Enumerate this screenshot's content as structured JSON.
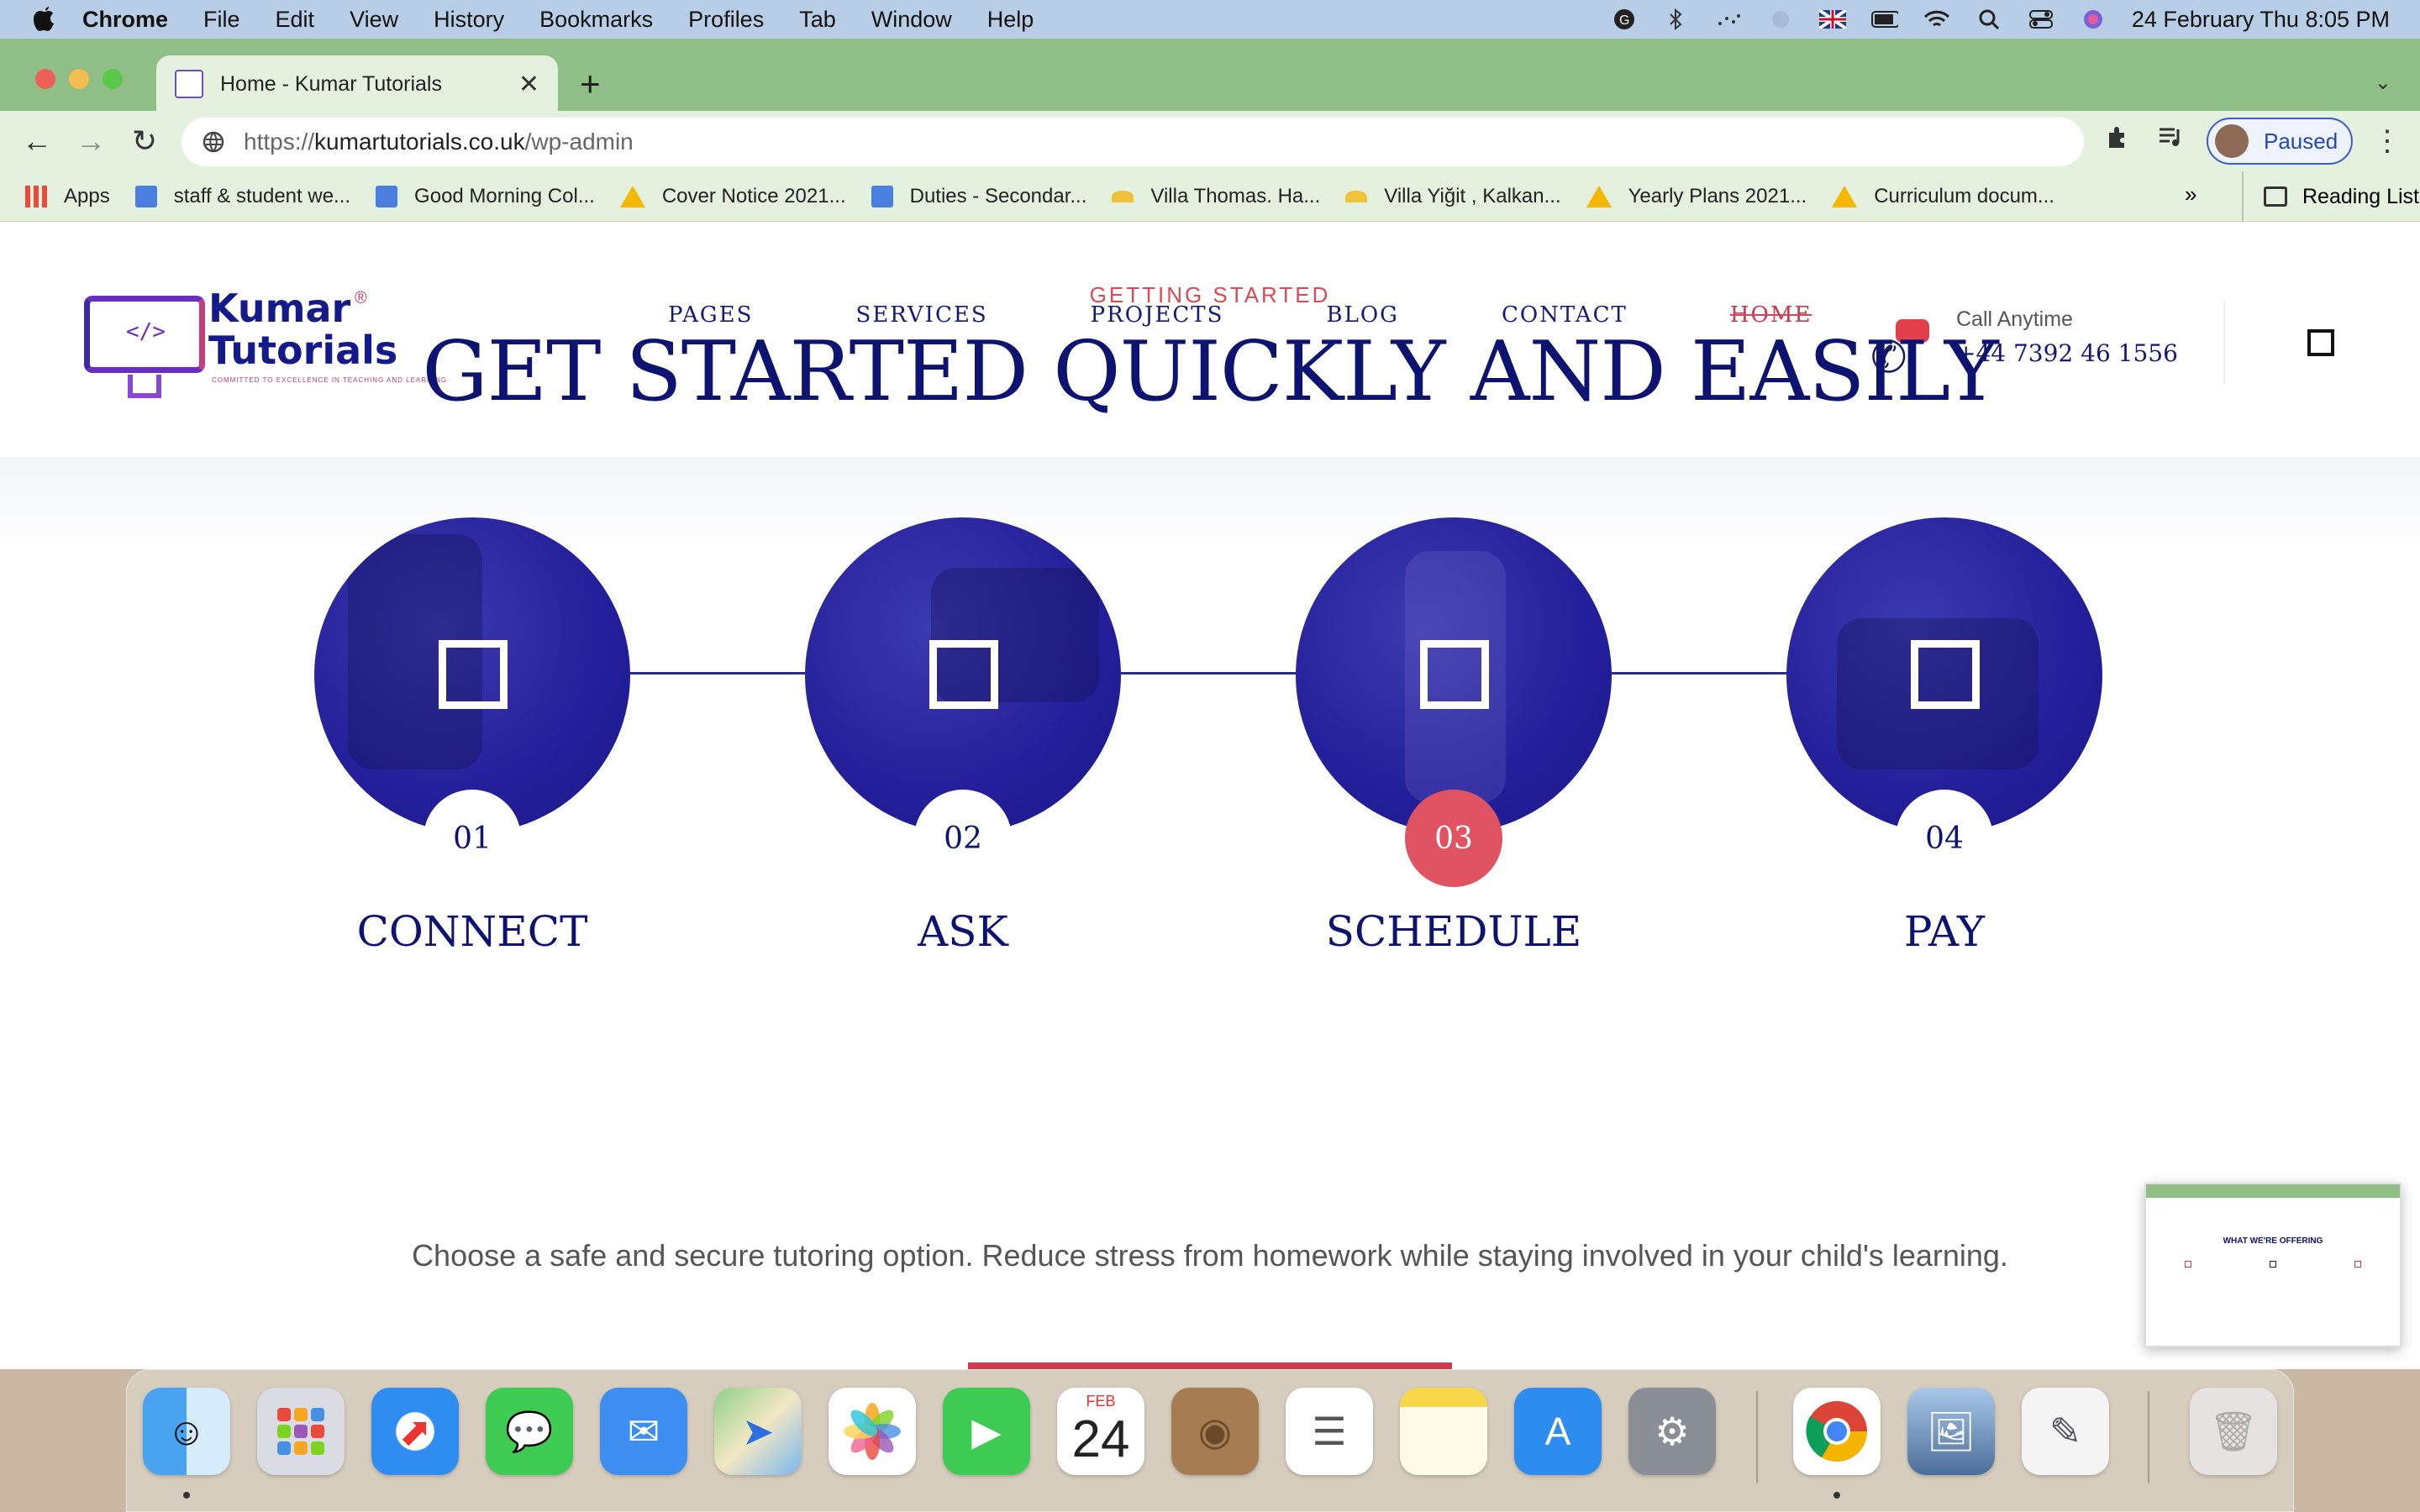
{
  "menubar": {
    "app": "Chrome",
    "items": [
      "File",
      "Edit",
      "View",
      "History",
      "Bookmarks",
      "Profiles",
      "Tab",
      "Window",
      "Help"
    ],
    "datetime": "24 February Thu  8:05 PM"
  },
  "browser": {
    "tab_title": "Home - Kumar Tutorials",
    "url_prefix": "https://",
    "url_host": "kumartutorials.co.uk",
    "url_path": "/wp-admin",
    "profile_status": "Paused",
    "bookmarks": [
      {
        "label": "Apps",
        "icon": "apps-grid-icon"
      },
      {
        "label": "staff & student we...",
        "icon": "docs-icon"
      },
      {
        "label": "Good Morning Col...",
        "icon": "docs-icon"
      },
      {
        "label": "Cover Notice 2021...",
        "icon": "drive-icon"
      },
      {
        "label": "Duties - Secondar...",
        "icon": "docs-icon"
      },
      {
        "label": "Villa Thomas. Ha...",
        "icon": "sunset-icon"
      },
      {
        "label": "Villa Yiğit , Kalkan...",
        "icon": "sunset-icon"
      },
      {
        "label": "Yearly Plans 2021...",
        "icon": "drive-icon"
      },
      {
        "label": "Curriculum docum...",
        "icon": "drive-icon"
      }
    ],
    "bookmarks_more": "»",
    "reading_list": "Reading List"
  },
  "site": {
    "logo": {
      "line1": "Kumar",
      "line2": "Tutorials",
      "reg": "®",
      "tagline": "COMMITTED TO EXCELLENCE IN TEACHING AND LEARNING",
      "code": "</>"
    },
    "nav": [
      {
        "label": "PAGES"
      },
      {
        "label": "SERVICES"
      },
      {
        "label": "PROJECTS"
      },
      {
        "label": "BLOG"
      },
      {
        "label": "CONTACT"
      },
      {
        "label": "HOME",
        "active": true
      }
    ],
    "call_label": "Call Anytime",
    "call_number": "+44 7392 46 1556",
    "eyebrow": "GETTING STARTED",
    "heading": "GET STARTED QUICKLY AND EASILY",
    "steps": [
      {
        "num": "01",
        "label": "CONNECT"
      },
      {
        "num": "02",
        "label": "ASK"
      },
      {
        "num": "03",
        "label": "SCHEDULE",
        "highlight": true
      },
      {
        "num": "04",
        "label": "PAY"
      }
    ],
    "description": "Choose a safe and secure tutoring option. Reduce stress from homework while staying involved in your child's learning.",
    "thumbnail_title": "WHAT WE'RE OFFERING"
  },
  "dock": {
    "calendar_month": "FEB",
    "calendar_day": "24",
    "apps": [
      "finder",
      "launchpad",
      "safari",
      "messages",
      "mail",
      "maps",
      "photos",
      "facetime",
      "calendar",
      "contacts",
      "reminders",
      "notes",
      "app-store",
      "system-preferences",
      "chrome",
      "preview",
      "textedit",
      "trash"
    ]
  },
  "colors": {
    "navy": "#0d1370",
    "accent": "#d64b55",
    "tabstrip": "#8fbf87"
  }
}
